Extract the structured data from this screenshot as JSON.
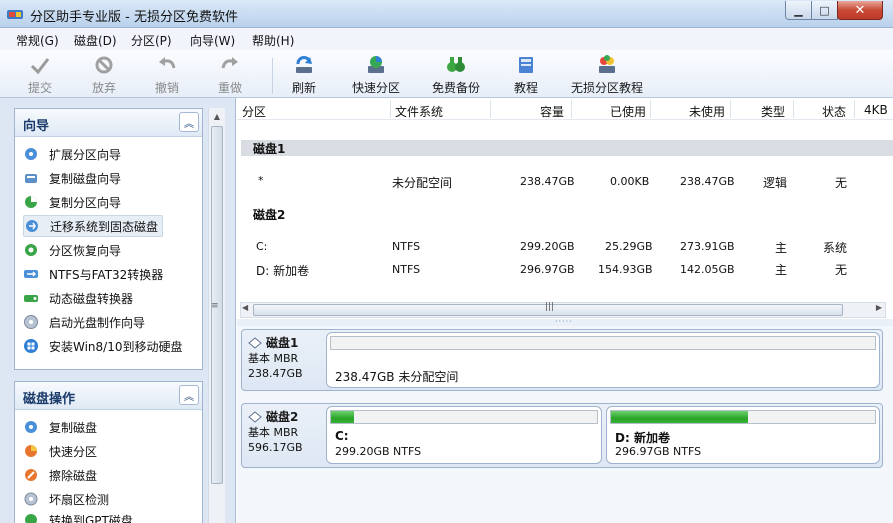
{
  "window": {
    "title": "分区助手专业版 - 无损分区免费软件"
  },
  "menu": [
    "常规(G)",
    "磁盘(D)",
    "分区(P)",
    "向导(W)",
    "帮助(H)"
  ],
  "toolbar": {
    "commit": "提交",
    "discard": "放弃",
    "undo": "撤销",
    "redo": "重做",
    "refresh": "刷新",
    "quick_partition": "快速分区",
    "free_backup": "免费备份",
    "tutorial": "教程",
    "lossless_tutorial": "无损分区教程"
  },
  "sidebar": {
    "wizard": {
      "title": "向导",
      "items": [
        "扩展分区向导",
        "复制磁盘向导",
        "复制分区向导",
        "迁移系统到固态磁盘",
        "分区恢复向导",
        "NTFS与FAT32转换器",
        "动态磁盘转换器",
        "启动光盘制作向导",
        "安装Win8/10到移动硬盘"
      ]
    },
    "disk_ops": {
      "title": "磁盘操作",
      "items": [
        "复制磁盘",
        "快速分区",
        "擦除磁盘",
        "坏扇区检测",
        "转换到GPT磁盘"
      ]
    }
  },
  "table": {
    "headers": [
      "分区",
      "文件系统",
      "容量",
      "已使用",
      "未使用",
      "类型",
      "状态",
      "4KB"
    ],
    "disk1_label": "磁盘1",
    "disk2_label": "磁盘2",
    "rows": [
      {
        "partition": "*",
        "fs": "未分配空间",
        "capacity": "238.47GB",
        "used": "0.00KB",
        "free": "238.47GB",
        "type": "逻辑",
        "status": "无"
      },
      {
        "partition": "C:",
        "fs": "NTFS",
        "capacity": "299.20GB",
        "used": "25.29GB",
        "free": "273.91GB",
        "type": "主",
        "status": "系统"
      },
      {
        "partition": "D: 新加卷",
        "fs": "NTFS",
        "capacity": "296.97GB",
        "used": "154.93GB",
        "free": "142.05GB",
        "type": "主",
        "status": "无"
      }
    ]
  },
  "disk_map": {
    "disk1": {
      "name": "磁盘1",
      "type": "基本 MBR",
      "size": "238.47GB",
      "partition_label": "238.47GB 未分配空间"
    },
    "disk2": {
      "name": "磁盘2",
      "type": "基本 MBR",
      "size": "596.17GB",
      "partitions": [
        {
          "name": "C:",
          "detail": "299.20GB NTFS",
          "used_fraction": 0.085
        },
        {
          "name": "D: 新加卷",
          "detail": "296.97GB NTFS",
          "used_fraction": 0.52
        }
      ]
    }
  },
  "colors": {
    "used_bar": "#2aa52a",
    "titlebar": "#c9dcf1",
    "sidebar_bg": "#dce7f3"
  }
}
